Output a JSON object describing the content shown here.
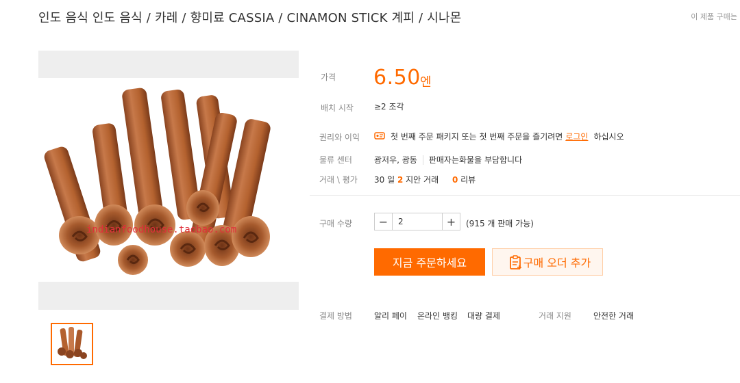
{
  "header": {
    "title": "인도 음식 인도 음식 / 카레 / 향미료 CASSIA / CINAMON STICK 계피 / 시나몬",
    "top_right_text": "이 제품 구매는"
  },
  "gallery": {
    "watermark": "indianfoodhouse.taobao.com"
  },
  "product": {
    "price_label": "가격",
    "price": "6.50",
    "price_unit": "엔",
    "batch_label": "배치 시작",
    "batch_value": "≥2 조각",
    "benefits_label": "권리와 이익",
    "benefits_text_before": "첫 번째 주문 패키지 또는 첫 번째 주문을 즐기려면",
    "benefits_login": "로그인",
    "benefits_text_after": "하십시오",
    "logistics_label": "물류 센터",
    "logistics_location": "광저우, 광동",
    "logistics_shipping": "판매자는화물을 부담합니다",
    "trade_label": "거래 \\ 평가",
    "trade_days": "30 일",
    "trade_count": "2",
    "trade_suffix": "지안 거래",
    "review_count": "0",
    "review_label": "리뷰"
  },
  "purchase": {
    "quantity_label": "구매 수량",
    "quantity_value": "2",
    "minus_symbol": "−",
    "plus_symbol": "+",
    "stock_text": "(915 개 판매 가능)",
    "buy_now_label": "지금 주문하세요",
    "add_cart_label": "구매 오더 추가"
  },
  "footer_info": {
    "payment_label": "결제 방법",
    "payment_methods": [
      "알리 페이",
      "온라인 뱅킹",
      "대량 결제"
    ],
    "support_label": "거래 지원",
    "support_value": "안전한 거래"
  },
  "colors": {
    "accent": "#ff6a00",
    "label_gray": "#888888",
    "image_bg": "#eeeeee",
    "cinnamon": "#b5653a"
  }
}
